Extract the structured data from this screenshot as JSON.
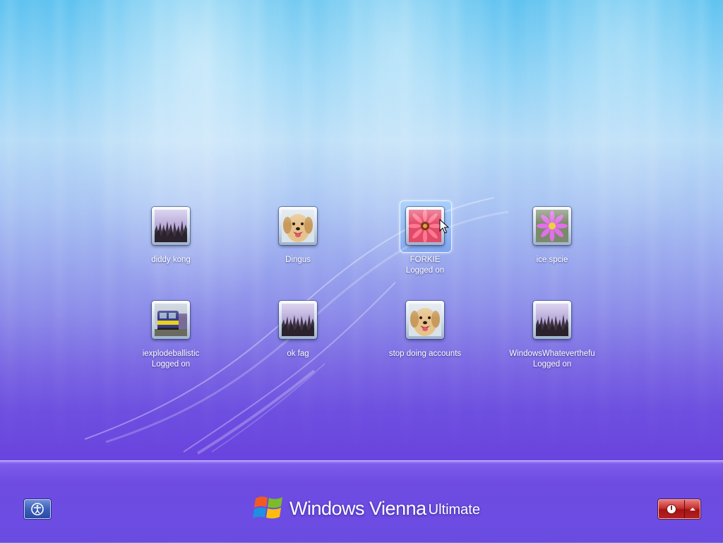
{
  "brand": {
    "word1": "Windows",
    "word2": "Vienna",
    "edition": "Ultimate"
  },
  "users": [
    {
      "name": "diddy kong",
      "status": "",
      "picture": "grass-field-picture",
      "selected": false
    },
    {
      "name": "Dingus",
      "status": "",
      "picture": "golden-retriever-picture",
      "selected": false
    },
    {
      "name": "FORKIE",
      "status": "Logged on",
      "picture": "red-gerbera-picture",
      "selected": true
    },
    {
      "name": "ice spcie",
      "status": "",
      "picture": "pink-flower-picture",
      "selected": false
    },
    {
      "name": "iexplodeballistic",
      "status": "Logged on",
      "picture": "train-picture",
      "selected": false
    },
    {
      "name": "ok fag",
      "status": "",
      "picture": "grass-field-picture",
      "selected": false
    },
    {
      "name": "stop doing accounts",
      "status": "",
      "picture": "golden-retriever-picture",
      "selected": false
    },
    {
      "name": "WindowsWhateverthefu",
      "status": "Logged on",
      "picture": "grass-field-picture",
      "selected": false
    }
  ],
  "buttons": {
    "ease_of_access_icon": "ease-of-access-icon",
    "power_icon": "power-icon",
    "options_icon": "up-arrow-icon"
  },
  "colors": {
    "sky_top": "#5fc3f0",
    "violet_bottom": "#6a44de",
    "power_red": "#c42a2a",
    "access_blue": "#3c5fb8"
  }
}
